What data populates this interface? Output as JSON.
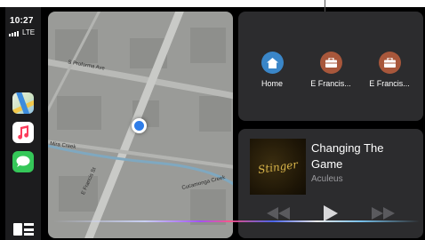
{
  "status": {
    "time": "10:27",
    "network": "LTE"
  },
  "map": {
    "streets": [
      "S Proforma Ave",
      "E Francis St",
      "Mira Creek",
      "Cucamonga Creek"
    ]
  },
  "destinations": [
    {
      "label": "Home",
      "icon": "house-icon"
    },
    {
      "label": "E Francis...",
      "icon": "briefcase-icon"
    },
    {
      "label": "E Francis...",
      "icon": "briefcase-icon"
    }
  ],
  "now_playing": {
    "title": "Changing The Game",
    "artist": "Aculeus",
    "album_art_text": "Stinger"
  },
  "colors": {
    "home": "#3a86c8",
    "work": "#a8573b",
    "location": "#2f7de8",
    "panel": "#2c2c2e"
  }
}
